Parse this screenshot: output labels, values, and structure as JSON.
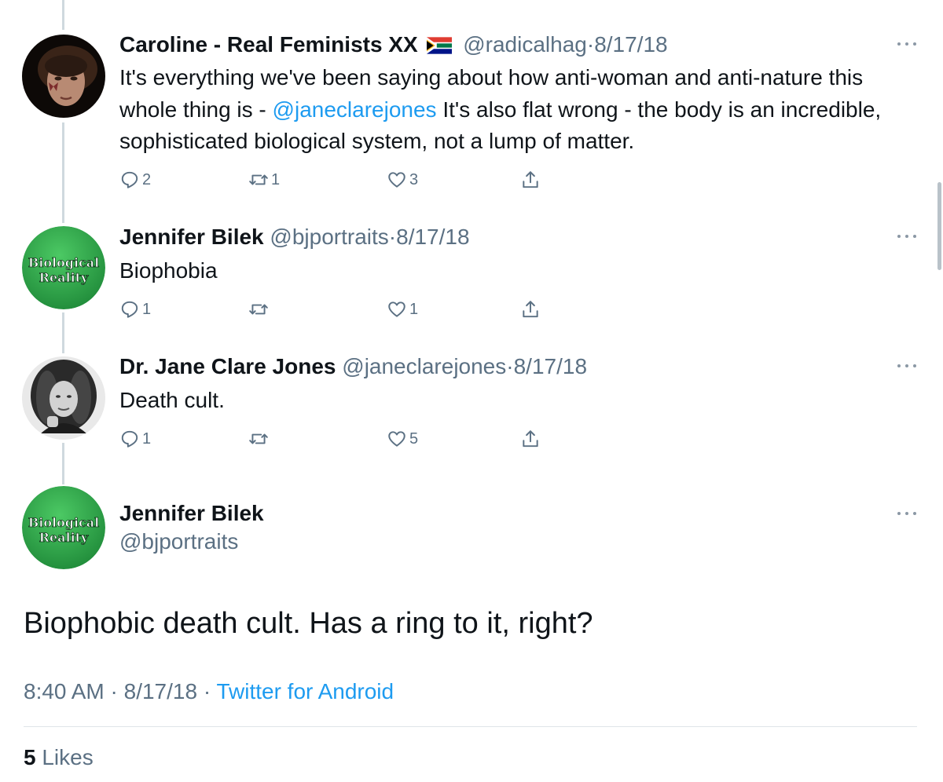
{
  "thread": [
    {
      "name": "Caroline - Real Feminists XX",
      "flag_icon": "south-africa-flag-icon",
      "handle": "@radicalhag",
      "separator": "·",
      "date": "8/17/18",
      "text_before": "It's everything we've been saying about how anti-woman and anti-nature this whole thing is - ",
      "mention": "@janeclarejones",
      "text_after": " It's also flat wrong - the body is an incredible, sophisticated biological system, not a lump of matter.",
      "reply_count": "2",
      "retweet_count": "1",
      "like_count": "3"
    },
    {
      "name": "Jennifer Bilek",
      "handle": "@bjportraits",
      "separator": "·",
      "date": "8/17/18",
      "text": "Biophobia",
      "avatar_text_1": "Biological",
      "avatar_text_2": "Reality",
      "reply_count": "1",
      "retweet_count": "",
      "like_count": "1"
    },
    {
      "name": "Dr. Jane Clare Jones",
      "handle": "@janeclarejones",
      "separator": "·",
      "date": "8/17/18",
      "text": "Death cult.",
      "reply_count": "1",
      "retweet_count": "",
      "like_count": "5"
    }
  ],
  "main_tweet": {
    "name": "Jennifer Bilek",
    "handle": "@bjportraits",
    "avatar_text_1": "Biological",
    "avatar_text_2": "Reality",
    "text": "Biophobic death cult. Has a ring to it, right?",
    "time": "8:40 AM",
    "separator": "·",
    "date": "8/17/18",
    "source": "Twitter for Android",
    "likes_count": "5",
    "likes_label": "Likes"
  },
  "colors": {
    "accent": "#1d9bf0",
    "secondary_text": "#5b7083",
    "avatar_green": "#2fa14a"
  }
}
